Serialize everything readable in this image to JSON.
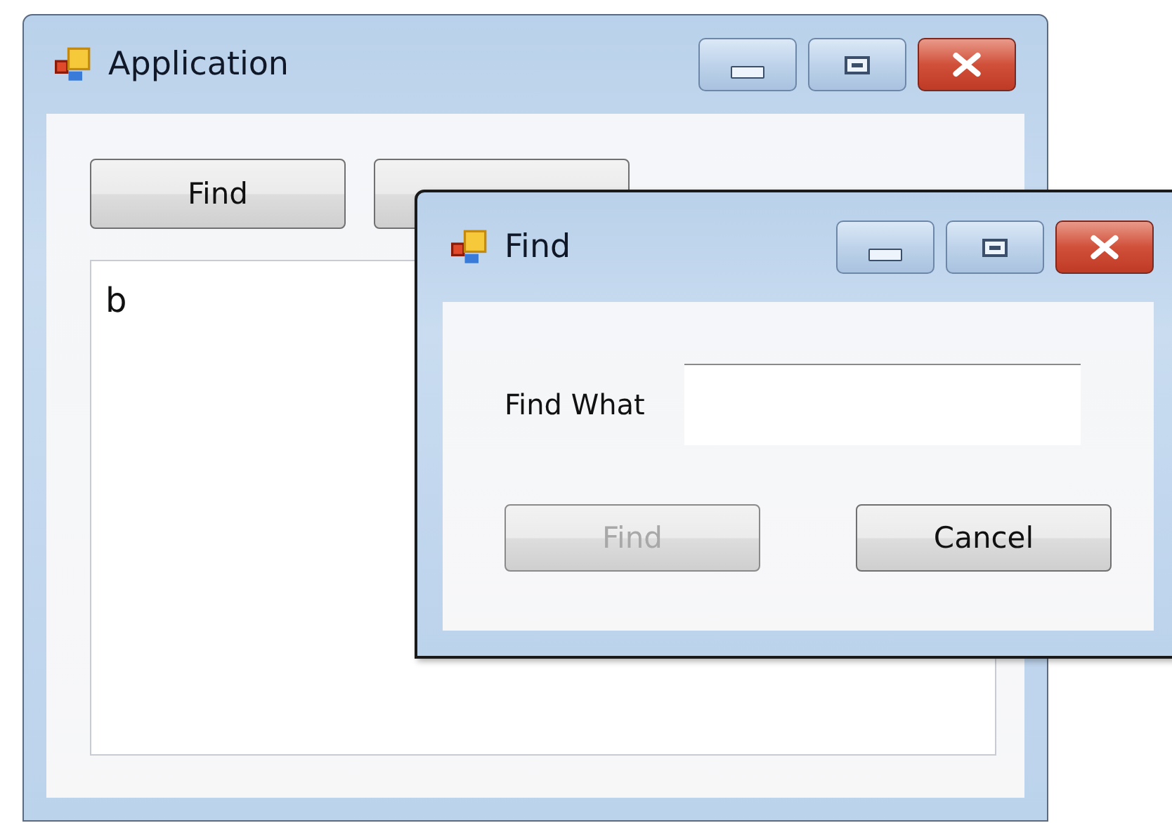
{
  "main_window": {
    "title": "Application",
    "find_button": {
      "label": "Find"
    },
    "text_area": {
      "value": "b"
    }
  },
  "find_dialog": {
    "title": "Find",
    "field": {
      "label": "Find What"
    },
    "buttons": [
      {
        "label": "Find",
        "disabled": true
      },
      {
        "label": "Cancel",
        "disabled": false
      }
    ]
  }
}
